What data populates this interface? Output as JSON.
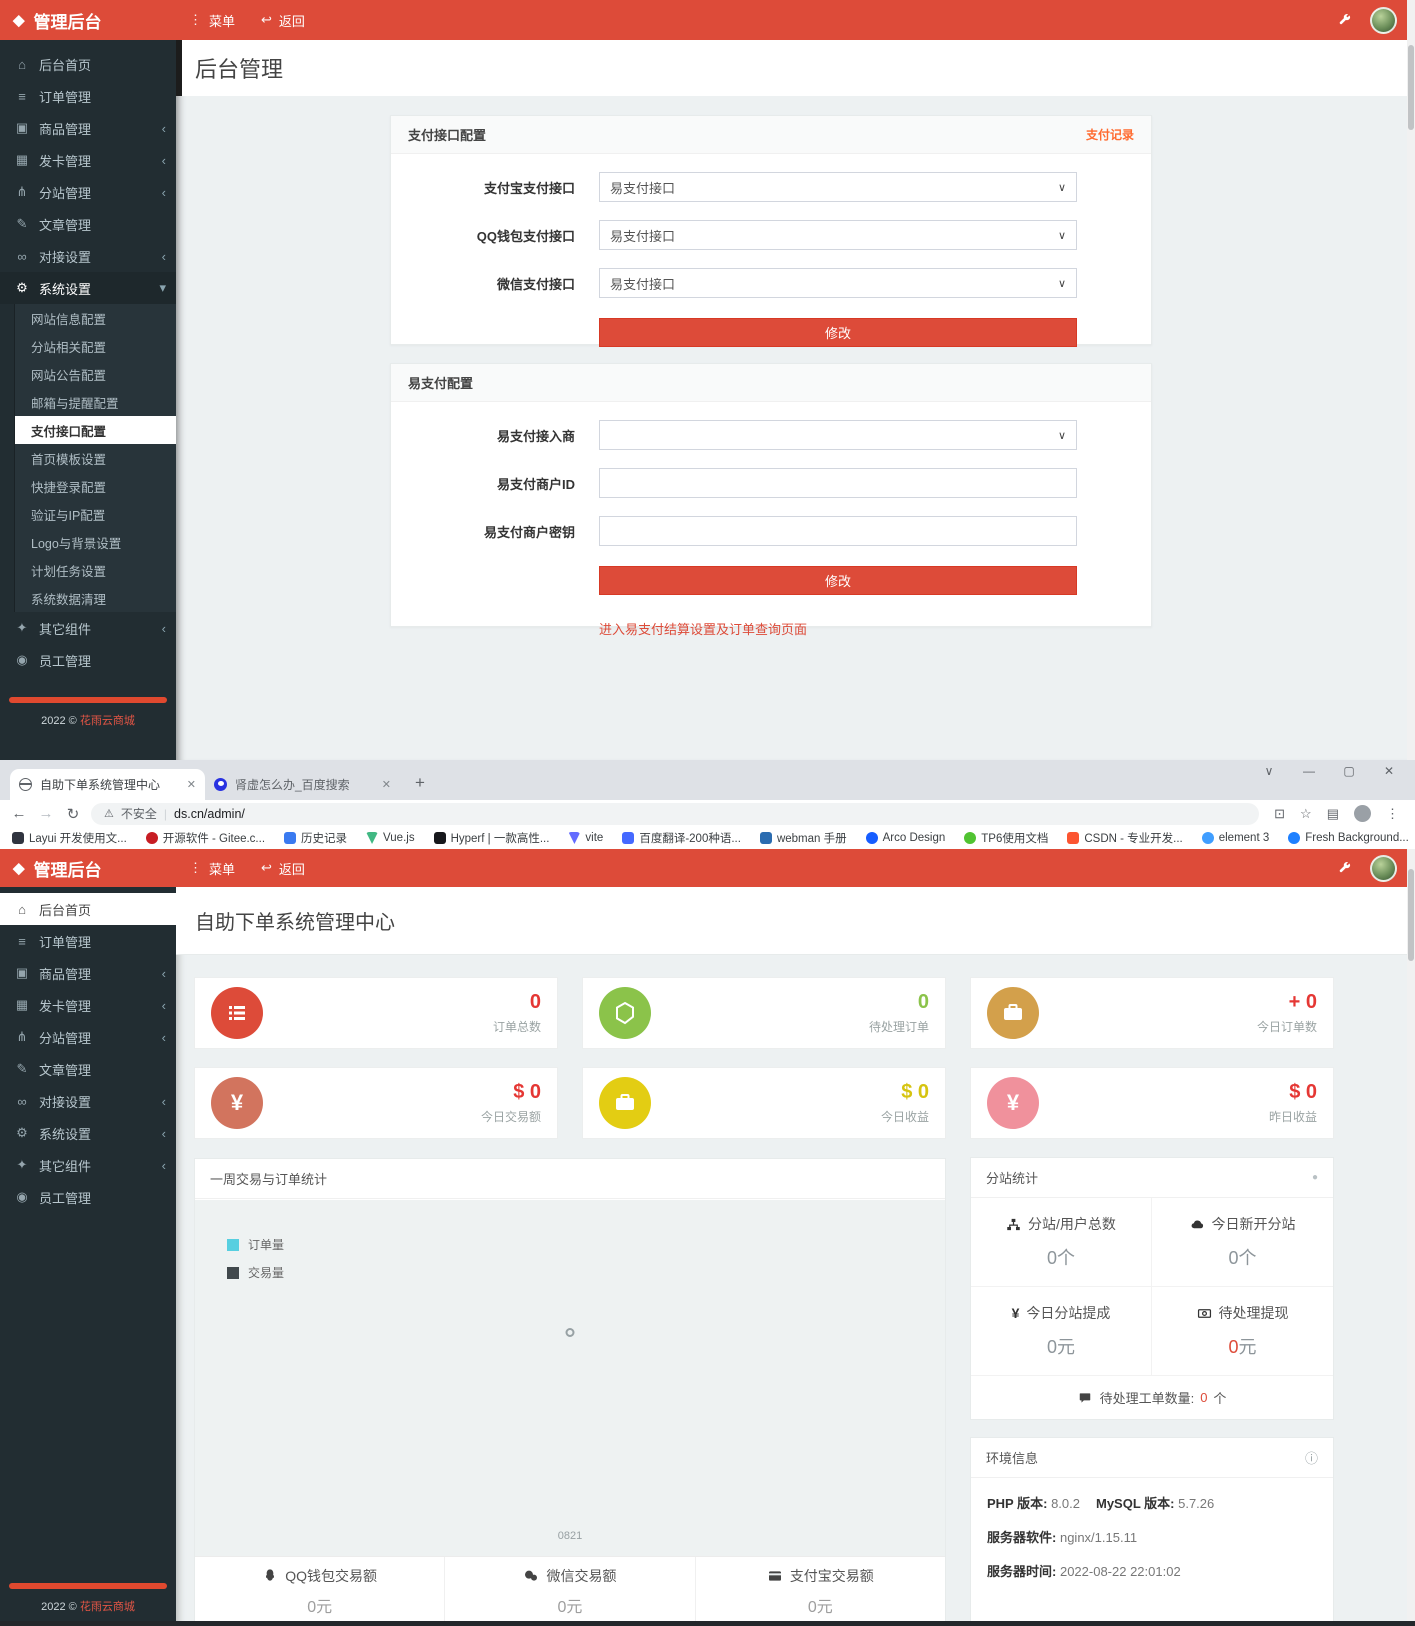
{
  "colors": {
    "brand_red": "#dd4b39",
    "sidebar_bg": "#222d32",
    "content_bg": "#edf1f2",
    "link_orange": "#ff6a2f",
    "danger_red": "#dd4b39"
  },
  "admin_top": {
    "brand": "管理后台",
    "menu": "菜单",
    "back": "返回",
    "page_title": "后台管理",
    "sidebar": {
      "items": [
        {
          "label": "后台首页"
        },
        {
          "label": "订单管理"
        },
        {
          "label": "商品管理"
        },
        {
          "label": "发卡管理"
        },
        {
          "label": "分站管理"
        },
        {
          "label": "文章管理"
        },
        {
          "label": "对接设置"
        },
        {
          "label": "系统设置"
        },
        {
          "label": "其它组件"
        },
        {
          "label": "员工管理"
        }
      ],
      "submenu": [
        "网站信息配置",
        "分站相关配置",
        "网站公告配置",
        "邮箱与提醒配置",
        "支付接口配置",
        "首页模板设置",
        "快捷登录配置",
        "验证与IP配置",
        "Logo与背景设置",
        "计划任务设置",
        "系统数据清理"
      ],
      "active_submenu": "支付接口配置",
      "footer_year": "2022 ©",
      "footer_brand": "花雨云商城"
    },
    "payment_card": {
      "title": "支付接口配置",
      "records_link": "支付记录",
      "fields": [
        {
          "label": "支付宝支付接口",
          "value": "易支付接口"
        },
        {
          "label": "QQ钱包支付接口",
          "value": "易支付接口"
        },
        {
          "label": "微信支付接口",
          "value": "易支付接口"
        }
      ],
      "submit": "修改"
    },
    "epay_card": {
      "title": "易支付配置",
      "fields": [
        {
          "label": "易支付接入商",
          "value": ""
        },
        {
          "label": "易支付商户ID",
          "value": ""
        },
        {
          "label": "易支付商户密钥",
          "value": ""
        }
      ],
      "submit": "修改",
      "footer_link": "进入易支付结算设置及订单查询页面"
    }
  },
  "browser": {
    "tabs": [
      {
        "title": "自助下单系统管理中心",
        "active": true
      },
      {
        "title": "肾虚怎么办_百度搜索",
        "active": false
      }
    ],
    "address": {
      "warning": "不安全",
      "url": "ds.cn/admin/"
    },
    "bookmarks": [
      "Layui 开发使用文...",
      "开源软件 - Gitee.c...",
      "历史记录",
      "Vue.js",
      "Hyperf | 一款高性...",
      "vite",
      "百度翻译-200种语...",
      "webman 手册",
      "Arco Design",
      "TP6使用文档",
      "CSDN - 专业开发...",
      "element 3",
      "Fresh Background..."
    ]
  },
  "admin_bottom": {
    "brand": "管理后台",
    "menu": "菜单",
    "back": "返回",
    "page_title": "自助下单系统管理中心",
    "sidebar": {
      "items": [
        {
          "label": "后台首页",
          "active": true
        },
        {
          "label": "订单管理"
        },
        {
          "label": "商品管理"
        },
        {
          "label": "发卡管理"
        },
        {
          "label": "分站管理"
        },
        {
          "label": "文章管理"
        },
        {
          "label": "对接设置"
        },
        {
          "label": "系统设置"
        },
        {
          "label": "其它组件"
        },
        {
          "label": "员工管理"
        }
      ],
      "footer_year": "2022 ©",
      "footer_brand": "花雨云商城"
    },
    "stats": [
      {
        "value": "0",
        "label": "订单总数",
        "circle_color": "#dd4b39",
        "icon": "ordered-list-icon"
      },
      {
        "value": "0",
        "label": "待处理订单",
        "circle_color": "#8bc34a",
        "icon": "cube-icon"
      },
      {
        "value": "+ 0",
        "label": "今日订单数",
        "circle_color": "#d3a04b",
        "icon": "briefcase-icon"
      },
      {
        "value": "$ 0",
        "label": "今日交易额",
        "circle_color": "#d2745e",
        "icon": "yen-icon"
      },
      {
        "value": "$ 0",
        "label": "今日收益",
        "circle_color": "#e3cd13",
        "icon": "briefcase-icon"
      },
      {
        "value": "$ 0",
        "label": "昨日收益",
        "circle_color": "#f0919c",
        "icon": "yen-icon"
      }
    ],
    "chart": {
      "type": "line",
      "title": "一周交易与订单统计",
      "legend": [
        {
          "label": "订单量",
          "color": "#57cfe0"
        },
        {
          "label": "交易量",
          "color": "#40484c"
        }
      ],
      "x_tick": "0821",
      "series_note": "empty / loading"
    },
    "substation": {
      "title": "分站统计",
      "cells": [
        {
          "label": "分站/用户总数",
          "num": "0",
          "unit": "个",
          "icon": "sitemap-icon"
        },
        {
          "label": "今日新开分站",
          "num": "0",
          "unit": "个",
          "icon": "cloud-icon"
        },
        {
          "label": "今日分站提成",
          "num": "0",
          "unit": "元",
          "icon": "yen-icon"
        },
        {
          "label": "待处理提现",
          "num": "0",
          "unit": "元",
          "icon": "banknote-icon"
        }
      ],
      "ticket_label": "待处理工单数量:",
      "ticket_num": "0",
      "ticket_unit": "个"
    },
    "env": {
      "title": "环境信息",
      "php_label": "PHP 版本:",
      "php_value": "8.0.2",
      "mysql_label": "MySQL 版本:",
      "mysql_value": "5.7.26",
      "software_label": "服务器软件:",
      "software_value": "nginx/1.15.11",
      "time_label": "服务器时间:",
      "time_value": "2022-08-22 22:01:02"
    },
    "totals": [
      {
        "label": "QQ钱包交易额",
        "value": "0元",
        "icon": "qq-icon"
      },
      {
        "label": "微信交易额",
        "value": "0元",
        "icon": "wechat-icon"
      },
      {
        "label": "支付宝交易额",
        "value": "0元",
        "icon": "credit-card-icon"
      }
    ]
  }
}
